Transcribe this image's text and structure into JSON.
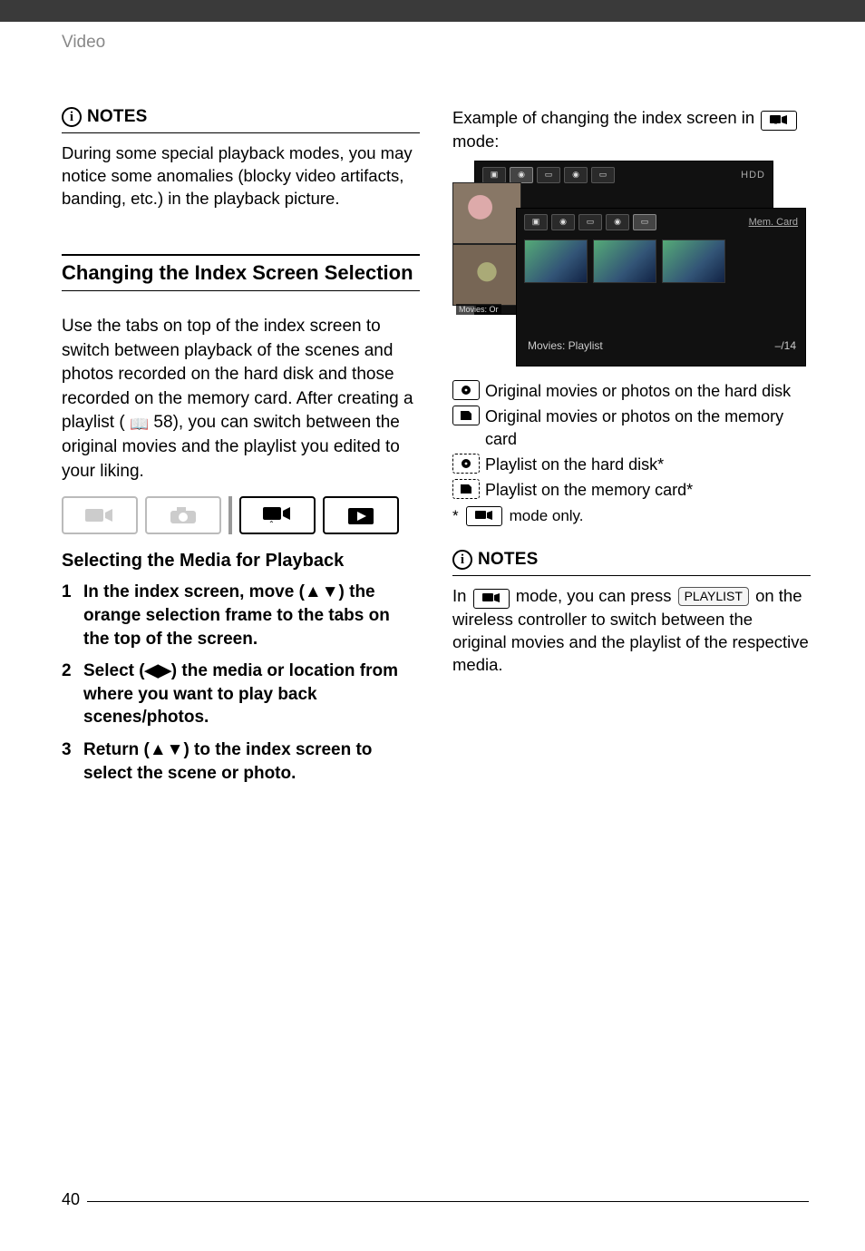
{
  "header": {
    "section_label": "Video"
  },
  "left": {
    "notes": {
      "label": "NOTES",
      "body": "During some special playback modes, you may notice some anomalies (blocky video artifacts, banding, etc.) in the playback picture."
    },
    "section_title": "Changing the Index Screen Selection",
    "intro_before_ref": "Use the tabs on top of the index screen to switch between playback of the scenes and photos recorded on the hard disk and those recorded on the memory card. After creating a playlist (",
    "page_ref": "58",
    "intro_after_ref": "), you can switch between the original movies and the playlist you edited to your liking.",
    "mode_icons": [
      "camcorder-rec-icon",
      "camera-rec-icon",
      "camcorder-play-icon",
      "photo-play-icon"
    ],
    "subheading": "Selecting the Media for Playback",
    "steps": [
      "In the index screen, move (▲▼) the orange selection frame to the tabs on the top of the screen.",
      "Select (◀▶) the media or location from where you want to play back scenes/photos.",
      "Return (▲▼) to the index screen to select the scene or photo."
    ]
  },
  "right": {
    "example_before_mode": "Example of changing the index screen in",
    "example_after_mode": "mode:",
    "screen": {
      "back_label_right": "HDD",
      "back_caption_left": "Movies: Or",
      "front_label_right": "Mem. Card",
      "front_caption_left": "Movies: Playlist",
      "front_caption_right": "–/14"
    },
    "legend": [
      {
        "style": "solid",
        "icon": "hdd-icon",
        "text": "Original movies or photos on the hard disk"
      },
      {
        "style": "solid",
        "icon": "sd-icon",
        "text": "Original movies or photos on the memory card"
      },
      {
        "style": "dashed",
        "icon": "hdd-icon",
        "text": "Playlist on the hard disk*"
      },
      {
        "style": "dashed",
        "icon": "sd-icon",
        "text": "Playlist on the memory card*"
      }
    ],
    "asterisk_before": "*",
    "asterisk_after": "mode only.",
    "notes": {
      "label": "NOTES",
      "body_before_mode": "In",
      "body_mid1": "mode, you can press",
      "playlist_btn": "PLAYLIST",
      "body_after_btn": "on the wireless controller to switch between the original movies and the playlist of the respective media."
    }
  },
  "page_number": "40",
  "icons": {
    "info": "i",
    "book": "📖"
  }
}
